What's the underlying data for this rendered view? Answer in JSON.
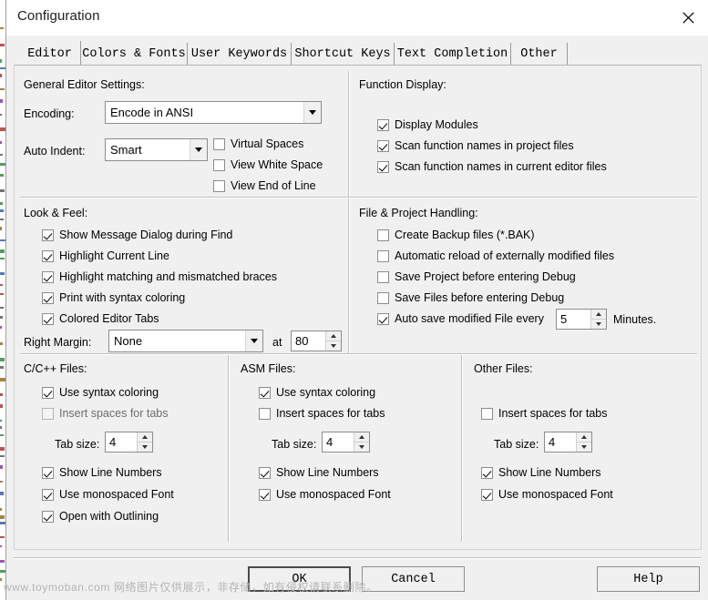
{
  "window": {
    "title": "Configuration",
    "close_icon": "close-icon"
  },
  "tabs": [
    {
      "label": "Editor",
      "active": true
    },
    {
      "label": "Colors & Fonts",
      "active": false
    },
    {
      "label": "User Keywords",
      "active": false
    },
    {
      "label": "Shortcut Keys",
      "active": false
    },
    {
      "label": "Text Completion",
      "active": false
    },
    {
      "label": "Other",
      "active": false
    }
  ],
  "general_editor": {
    "group_label": "General Editor Settings:",
    "encoding_label": "Encoding:",
    "encoding_value": "Encode in ANSI",
    "auto_indent_label": "Auto Indent:",
    "auto_indent_value": "Smart",
    "checks": [
      {
        "label": "Virtual Spaces",
        "checked": false
      },
      {
        "label": "View White Space",
        "checked": false
      },
      {
        "label": "View End of Line",
        "checked": false
      }
    ]
  },
  "function_display": {
    "group_label": "Function Display:",
    "checks": [
      {
        "label": "Display Modules",
        "checked": true
      },
      {
        "label": "Scan function names in project files",
        "checked": true
      },
      {
        "label": "Scan function names in current editor files",
        "checked": true
      }
    ]
  },
  "look_feel": {
    "group_label": "Look & Feel:",
    "checks": [
      {
        "label": "Show Message Dialog during Find",
        "checked": true
      },
      {
        "label": "Highlight Current Line",
        "checked": true
      },
      {
        "label": "Highlight matching and mismatched braces",
        "checked": true
      },
      {
        "label": "Print with syntax coloring",
        "checked": true
      },
      {
        "label": "Colored Editor Tabs",
        "checked": true
      }
    ],
    "right_margin_label": "Right Margin:",
    "right_margin_value": "None",
    "at_label": "at",
    "at_value": "80"
  },
  "file_project": {
    "group_label": "File & Project Handling:",
    "checks": [
      {
        "label": "Create Backup files (*.BAK)",
        "checked": false
      },
      {
        "label": "Automatic reload of externally modified files",
        "checked": false
      },
      {
        "label": "Save Project before entering Debug",
        "checked": false
      },
      {
        "label": "Save Files before entering Debug",
        "checked": false
      }
    ],
    "autosave_label": "Auto save modified File every",
    "autosave_checked": true,
    "autosave_value": "5",
    "minutes_label": "Minutes."
  },
  "cpp_files": {
    "group_label": "C/C++ Files:",
    "syntax_label": "Use syntax coloring",
    "syntax_checked": true,
    "spaces_label": "Insert spaces for tabs",
    "spaces_checked": false,
    "spaces_disabled": true,
    "tabsize_label": "Tab size:",
    "tabsize_value": "4",
    "line_numbers_label": "Show Line Numbers",
    "line_numbers_checked": true,
    "mono_label": "Use monospaced Font",
    "mono_checked": true,
    "outlining_label": "Open with Outlining",
    "outlining_checked": true
  },
  "asm_files": {
    "group_label": "ASM Files:",
    "syntax_label": "Use syntax coloring",
    "syntax_checked": true,
    "spaces_label": "Insert spaces for tabs",
    "spaces_checked": false,
    "tabsize_label": "Tab size:",
    "tabsize_value": "4",
    "line_numbers_label": "Show Line Numbers",
    "line_numbers_checked": true,
    "mono_label": "Use monospaced Font",
    "mono_checked": true
  },
  "other_files": {
    "group_label": "Other Files:",
    "spaces_label": "Insert spaces for tabs",
    "spaces_checked": false,
    "tabsize_label": "Tab size:",
    "tabsize_value": "4",
    "line_numbers_label": "Show Line Numbers",
    "line_numbers_checked": true,
    "mono_label": "Use monospaced Font",
    "mono_checked": true
  },
  "buttons": {
    "ok": "OK",
    "cancel": "Cancel",
    "help": "Help"
  },
  "watermark": "www.toymoban.com 网络图片仅供展示，非存储，如有侵权请联系删除。",
  "colors": {
    "dialog_face": "#f0f0f0",
    "field_bg": "#ffffff",
    "border": "#8d8d8d",
    "text": "#000000",
    "disabled_text": "#6d6d6d",
    "watermark": "#b4b4b4"
  }
}
